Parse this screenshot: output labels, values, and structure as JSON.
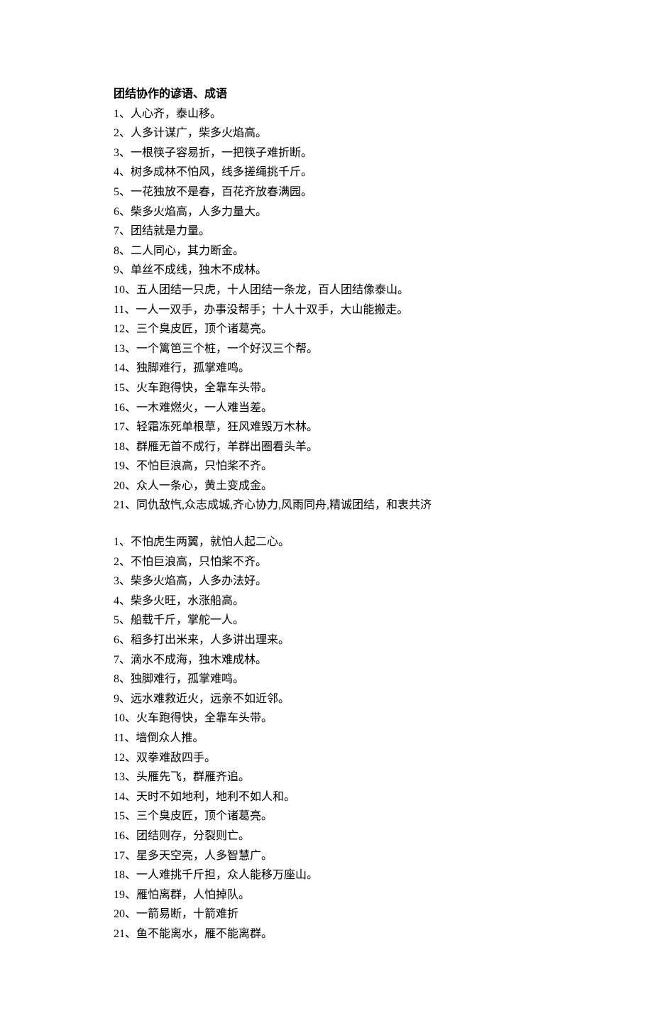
{
  "title": "团结协作的谚语、成语",
  "section1": [
    "1、人心齐，泰山移。",
    "2、人多计谋广，柴多火焰高。",
    "3、一根筷子容易折，一把筷子难折断。",
    "4、树多成林不怕风，线多搓绳挑千斤。",
    "5、一花独放不是春，百花齐放春满园。",
    "6、柴多火焰高，人多力量大。",
    "7、团结就是力量。",
    "8、二人同心，其力断金。",
    "9、单丝不成线，独木不成林。",
    "10、五人团结一只虎，十人团结一条龙，百人团结像泰山。",
    "11、一人一双手，办事没帮手；十人十双手，大山能搬走。",
    "12、三个臭皮匠，顶个诸葛亮。",
    "13、一个篱笆三个桩，一个好汉三个帮。",
    "14、独脚难行，孤掌难鸣。",
    "15、火车跑得快，全靠车头带。",
    "16、一木难燃火，一人难当差。",
    "17、轻霜冻死单根草，狂风难毁万木林。",
    "18、群雁无首不成行，羊群出圈看头羊。",
    "19、不怕巨浪高，只怕桨不齐。",
    "20、众人一条心，黄土变成金。",
    "21、同仇敌忾,众志成城,齐心协力,风雨同舟,精诚团结，和衷共济"
  ],
  "section2": [
    "1、不怕虎生两翼，就怕人起二心。",
    "2、不怕巨浪高，只怕桨不齐。",
    "3、柴多火焰高，人多办法好。",
    "4、柴多火旺，水涨船高。",
    "5、船载千斤，掌舵一人。",
    "6、稻多打出米来，人多讲出理来。",
    "7、滴水不成海，独木难成林。",
    "8、独脚难行，孤掌难鸣。",
    "9、远水难救近火，远亲不如近邻。",
    "10、火车跑得快，全靠车头带。",
    "11、墙倒众人推。",
    "12、双拳难敌四手。",
    "13、头雁先飞，群雁齐追。",
    "14、天时不如地利，地利不如人和。",
    "15、三个臭皮匠，顶个诸葛亮。",
    "16、团结则存，分裂则亡。",
    "17、星多天空亮，人多智慧广。",
    "18、一人难挑千斤担，众人能移万座山。",
    "19、雁怕离群，人怕掉队。",
    "20、一箭易断，十箭难折",
    "21、鱼不能离水，雁不能离群。"
  ]
}
